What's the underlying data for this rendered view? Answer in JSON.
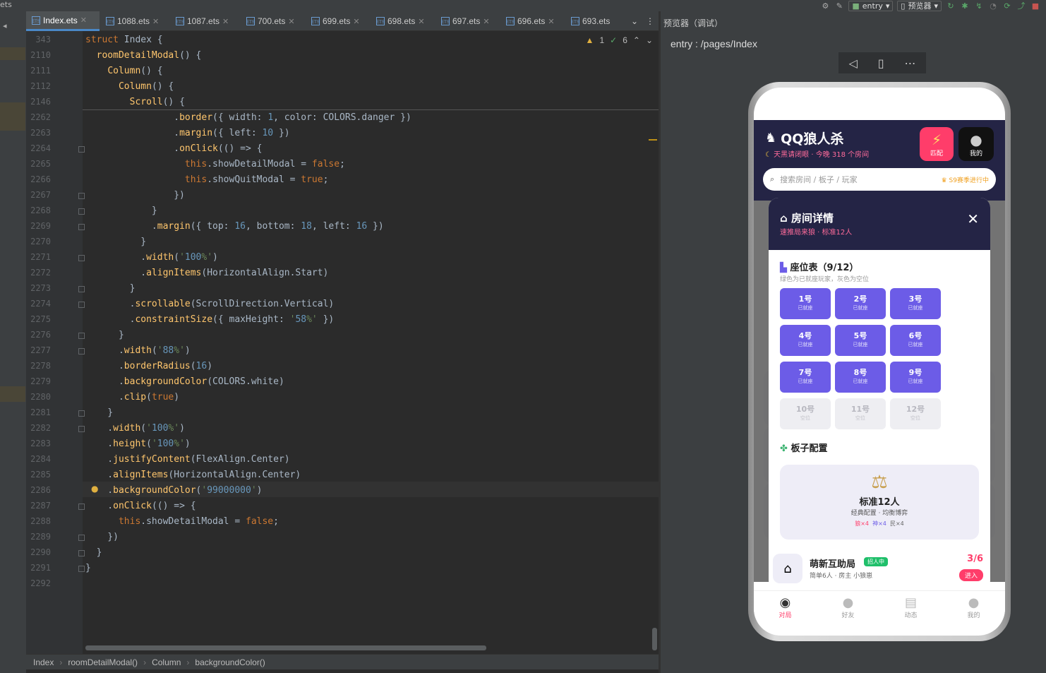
{
  "window": {
    "title_fragment": "ets"
  },
  "toolbar": {
    "run_config": "entry",
    "previewer_btn": "预览器"
  },
  "tabs": [
    {
      "label": "Index.ets",
      "active": true
    },
    {
      "label": "1088.ets"
    },
    {
      "label": "1087.ets"
    },
    {
      "label": "700.ets"
    },
    {
      "label": "699.ets"
    },
    {
      "label": "698.ets"
    },
    {
      "label": "697.ets"
    },
    {
      "label": "696.ets"
    },
    {
      "label": "693.ets"
    }
  ],
  "inspection": {
    "warnings": "1",
    "weak_warnings": "6"
  },
  "code_lines": [
    {
      "num": "343",
      "text": "struct Index {"
    },
    {
      "num": "2110",
      "text": "  roomDetailModal() {"
    },
    {
      "num": "2111",
      "text": "    Column() {"
    },
    {
      "num": "2112",
      "text": "      Column() {"
    },
    {
      "num": "2146",
      "text": "        Scroll() {"
    },
    {
      "num": "2262",
      "text": "                .border({ width: 1, color: COLORS.danger })"
    },
    {
      "num": "2263",
      "text": "                .margin({ left: 10 })"
    },
    {
      "num": "2264",
      "text": "                .onClick(() => {"
    },
    {
      "num": "2265",
      "text": "                  this.showDetailModal = false;"
    },
    {
      "num": "2266",
      "text": "                  this.showQuitModal = true;"
    },
    {
      "num": "2267",
      "text": "                })"
    },
    {
      "num": "2268",
      "text": "            }"
    },
    {
      "num": "2269",
      "text": "            .margin({ top: 16, bottom: 18, left: 16 })"
    },
    {
      "num": "2270",
      "text": "          }"
    },
    {
      "num": "2271",
      "text": "          .width('100%')"
    },
    {
      "num": "2272",
      "text": "          .alignItems(HorizontalAlign.Start)"
    },
    {
      "num": "2273",
      "text": "        }"
    },
    {
      "num": "2274",
      "text": "        .scrollable(ScrollDirection.Vertical)"
    },
    {
      "num": "2275",
      "text": "        .constraintSize({ maxHeight: '58%' })"
    },
    {
      "num": "2276",
      "text": "      }"
    },
    {
      "num": "2277",
      "text": "      .width('88%')"
    },
    {
      "num": "2278",
      "text": "      .borderRadius(16)"
    },
    {
      "num": "2279",
      "text": "      .backgroundColor(COLORS.white)"
    },
    {
      "num": "2280",
      "text": "      .clip(true)"
    },
    {
      "num": "2281",
      "text": "    }"
    },
    {
      "num": "2282",
      "text": "    .width('100%')"
    },
    {
      "num": "2283",
      "text": "    .height('100%')"
    },
    {
      "num": "2284",
      "text": "    .justifyContent(FlexAlign.Center)"
    },
    {
      "num": "2285",
      "text": "    .alignItems(HorizontalAlign.Center)"
    },
    {
      "num": "2286",
      "text": "    .backgroundColor('99000000')"
    },
    {
      "num": "2287",
      "text": "    .onClick(() => {"
    },
    {
      "num": "2288",
      "text": "      this.showDetailModal = false;"
    },
    {
      "num": "2289",
      "text": "    })"
    },
    {
      "num": "2290",
      "text": "  }"
    },
    {
      "num": "2291",
      "text": "}"
    },
    {
      "num": "2292",
      "text": ""
    }
  ],
  "breadcrumb": [
    "Index",
    "roomDetailModal()",
    "Column",
    "backgroundColor()"
  ],
  "previewer": {
    "title": "预览器（调试）",
    "route": "entry : /pages/Index",
    "app": {
      "title": "QQ狼人杀",
      "subtitle": "天黑请闭眼 · 今晚 318 个房间",
      "match_label": "匹配",
      "me_label": "我的",
      "search_placeholder": "搜索房间 / 板子 / 玩家",
      "season_badge": "S9赛季进行中",
      "modal": {
        "title": "房间详情",
        "subtitle": "速推局来狼 · 标准12人",
        "seat_section_title": "座位表（9/12）",
        "seat_section_sub": "绿色为已就座玩家，灰色为空位",
        "seats": [
          {
            "label": "1号",
            "status": "已就座"
          },
          {
            "label": "2号",
            "status": "已就座"
          },
          {
            "label": "3号",
            "status": "已就座"
          },
          {
            "label": "4号",
            "status": "已就座"
          },
          {
            "label": "5号",
            "status": "已就座"
          },
          {
            "label": "6号",
            "status": "已就座"
          },
          {
            "label": "7号",
            "status": "已就座"
          },
          {
            "label": "8号",
            "status": "已就座"
          },
          {
            "label": "9号",
            "status": "已就座"
          },
          {
            "label": "10号",
            "status": "空位"
          },
          {
            "label": "11号",
            "status": "空位"
          },
          {
            "label": "12号",
            "status": "空位"
          }
        ],
        "board_section_title": "板子配置",
        "board_name": "标准12人",
        "board_desc": "经典配置 · 均衡博弈",
        "roles": {
          "wolf": "狼×4",
          "god": "神×4",
          "villager": "民×4"
        }
      },
      "room_card": {
        "name": "萌新互助局",
        "tag": "招人中",
        "desc": "简单6人 · 房主 小狼崽",
        "count": "3/6",
        "enter": "进入"
      },
      "tabbar": [
        {
          "label": "对局",
          "active": true
        },
        {
          "label": "好友"
        },
        {
          "label": "动态"
        },
        {
          "label": "我的"
        }
      ]
    }
  }
}
